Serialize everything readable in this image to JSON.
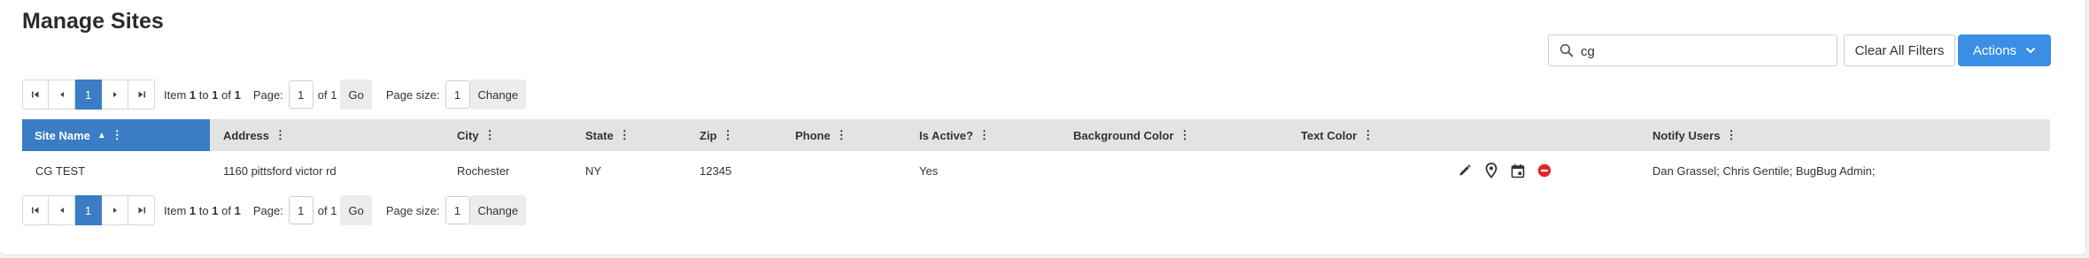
{
  "page": {
    "title": "Manage Sites"
  },
  "toolbar": {
    "search_value": "cg",
    "clear_filters_label": "Clear All Filters",
    "actions_label": "Actions"
  },
  "pager": {
    "current_page": "1",
    "item_prefix": "Item",
    "item_start": "1",
    "item_to": "to",
    "item_end": "1",
    "item_of": "of",
    "item_total": "1",
    "page_label": "Page:",
    "page_value": "1",
    "page_of_text": "of 1",
    "go_label": "Go",
    "page_size_label": "Page size:",
    "page_size_value": "1",
    "change_label": "Change"
  },
  "table": {
    "columns": [
      "Site Name",
      "Address",
      "City",
      "State",
      "Zip",
      "Phone",
      "Is Active?",
      "Background Color",
      "Text Color",
      "Notify Users"
    ],
    "rows": [
      {
        "site_name": "CG TEST",
        "address": "1160 pittsford victor rd",
        "city": "Rochester",
        "state": "NY",
        "zip": "12345",
        "phone": "",
        "is_active": "Yes",
        "background_color": "",
        "text_color": "",
        "notify_users": "Dan Grassel; Chris Gentile; BugBug Admin;"
      }
    ]
  },
  "icons": {
    "search": "search-icon",
    "actions_caret": "chevron-down-icon",
    "edit": "pencil-icon",
    "location": "map-pin-icon",
    "calendar": "calendar-icon",
    "delete": "remove-icon"
  },
  "colors": {
    "accent": "#3a8ee6",
    "header_sorted": "#3a7dc4",
    "header_bg": "#e3e3e3",
    "delete": "#e0262b"
  }
}
